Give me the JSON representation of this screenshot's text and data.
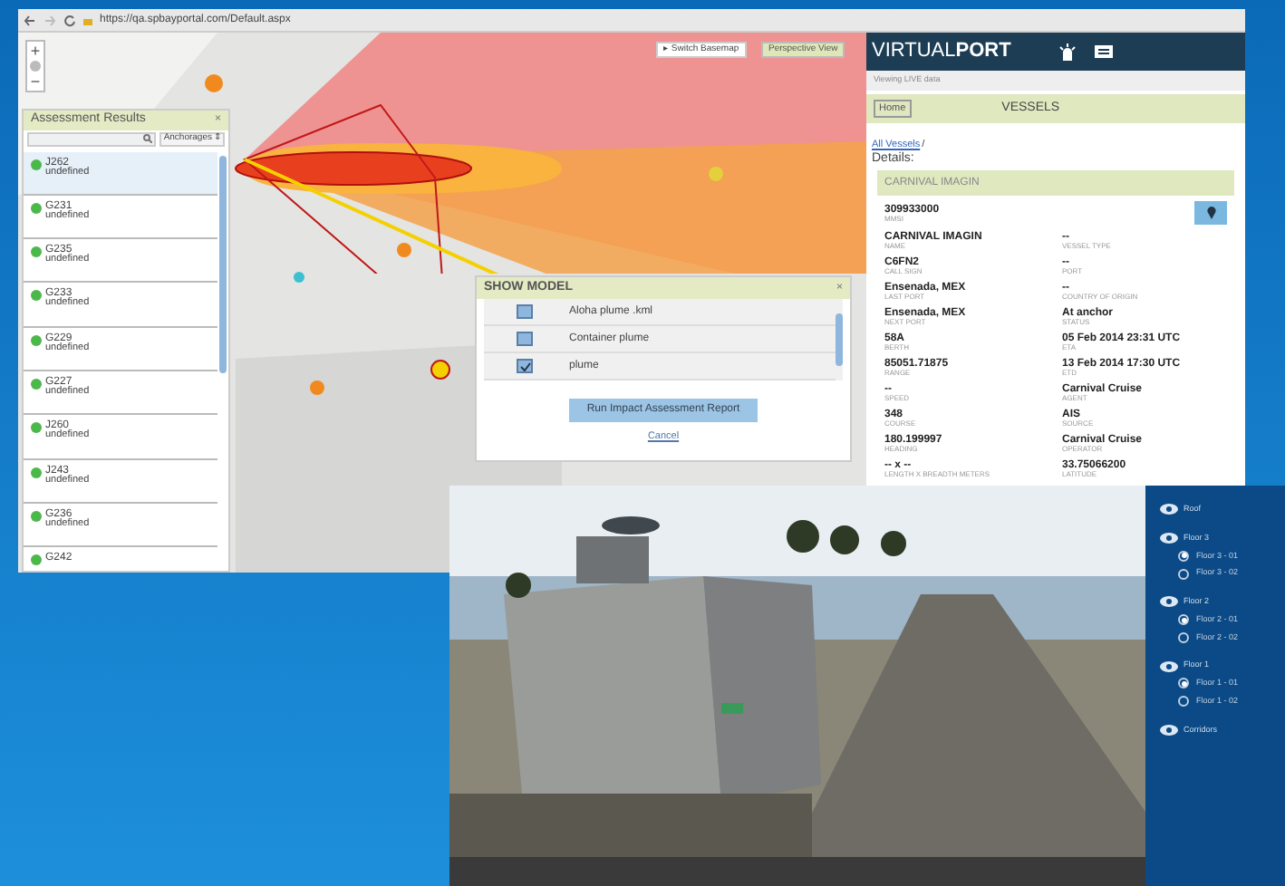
{
  "browser": {
    "url": "https://qa.spbayportal.com/Default.aspx"
  },
  "map": {
    "zoom_in": "+",
    "zoom_out": "−",
    "switch_basemap": "▸ Switch Basemap",
    "perspective_view": "Perspective View"
  },
  "assessment_panel": {
    "title": "Assessment Results",
    "close": "×",
    "filter": "Anchorages",
    "filter_arrow": "⇕",
    "rows": [
      {
        "name": "J262",
        "status": "undefined",
        "selected": true
      },
      {
        "name": "G231",
        "status": "undefined",
        "selected": false
      },
      {
        "name": "G235",
        "status": "undefined",
        "selected": false
      },
      {
        "name": "G233",
        "status": "undefined",
        "selected": false
      },
      {
        "name": "G229",
        "status": "undefined",
        "selected": false
      },
      {
        "name": "G227",
        "status": "undefined",
        "selected": false
      },
      {
        "name": "J260",
        "status": "undefined",
        "selected": false
      },
      {
        "name": "J243",
        "status": "undefined",
        "selected": false
      },
      {
        "name": "G236",
        "status": "undefined",
        "selected": false
      },
      {
        "name": "G242",
        "selected": false
      }
    ]
  },
  "show_model": {
    "title": "SHOW MODEL",
    "close": "×",
    "items": [
      {
        "label": "Aloha plume .kml",
        "checked": false
      },
      {
        "label": "Container plume",
        "checked": false
      },
      {
        "label": "plume",
        "checked": true
      }
    ],
    "run_button": "Run Impact Assessment Report",
    "cancel": "Cancel"
  },
  "virtualport": {
    "logo": "VIRTUAL**PORT**",
    "live_note": "Viewing LIVE data",
    "home": "Home",
    "section": "VESSELS",
    "breadcrumb": "All Vessels",
    "breadcrumb_sep": "/",
    "details": "Details:",
    "vessel_header": "CARNIVAL IMAGIN",
    "mmsi": {
      "value": "309933000",
      "label": "MMSI"
    },
    "left_fields": [
      {
        "value": "CARNIVAL IMAGIN",
        "label": "NAME"
      },
      {
        "value": "C6FN2",
        "label": "CALL SIGN"
      },
      {
        "value": "Ensenada, MEX",
        "label": "LAST PORT"
      },
      {
        "value": "Ensenada, MEX",
        "label": "NEXT PORT"
      },
      {
        "value": "58A",
        "label": "BERTH"
      },
      {
        "value": "85051.71875",
        "label": "RANGE"
      },
      {
        "value": "--",
        "label": "SPEED"
      },
      {
        "value": "348",
        "label": "COURSE"
      },
      {
        "value": "180.199997",
        "label": "HEADING"
      },
      {
        "value": "-- x --",
        "label": "LENGTH X BREADTH METERS"
      }
    ],
    "right_fields": [
      {
        "value": "--",
        "label": "VESSEL TYPE"
      },
      {
        "value": "--",
        "label": "PORT"
      },
      {
        "value": "--",
        "label": "COUNTRY OF ORIGIN"
      },
      {
        "value": "At anchor",
        "label": "STATUS"
      },
      {
        "value": "05 Feb 2014 23:31 UTC",
        "label": "ETA"
      },
      {
        "value": "13 Feb 2014 17:30 UTC",
        "label": "ETD"
      },
      {
        "value": "Carnival Cruise",
        "label": "AGENT"
      },
      {
        "value": "AIS",
        "label": "SOURCE"
      },
      {
        "value": "Carnival Cruise",
        "label": "OPERATOR"
      },
      {
        "value": "33.75066200",
        "label": "LATITUDE"
      }
    ]
  },
  "viewer": {
    "layers": [
      {
        "name": "Roof"
      },
      {
        "name": "Floor 3",
        "options": [
          {
            "label": "Floor 3 - 01",
            "selected": true
          },
          {
            "label": "Floor 3 - 02",
            "selected": false
          }
        ]
      },
      {
        "name": "Floor 2",
        "options": [
          {
            "label": "Floor 2 - 01",
            "selected": true
          },
          {
            "label": "Floor 2 - 02",
            "selected": false
          }
        ]
      },
      {
        "name": "Floor 1",
        "options": [
          {
            "label": "Floor 1 - 01",
            "selected": true
          },
          {
            "label": "Floor 1 - 02",
            "selected": false
          }
        ]
      },
      {
        "name": "Corridors"
      }
    ]
  }
}
